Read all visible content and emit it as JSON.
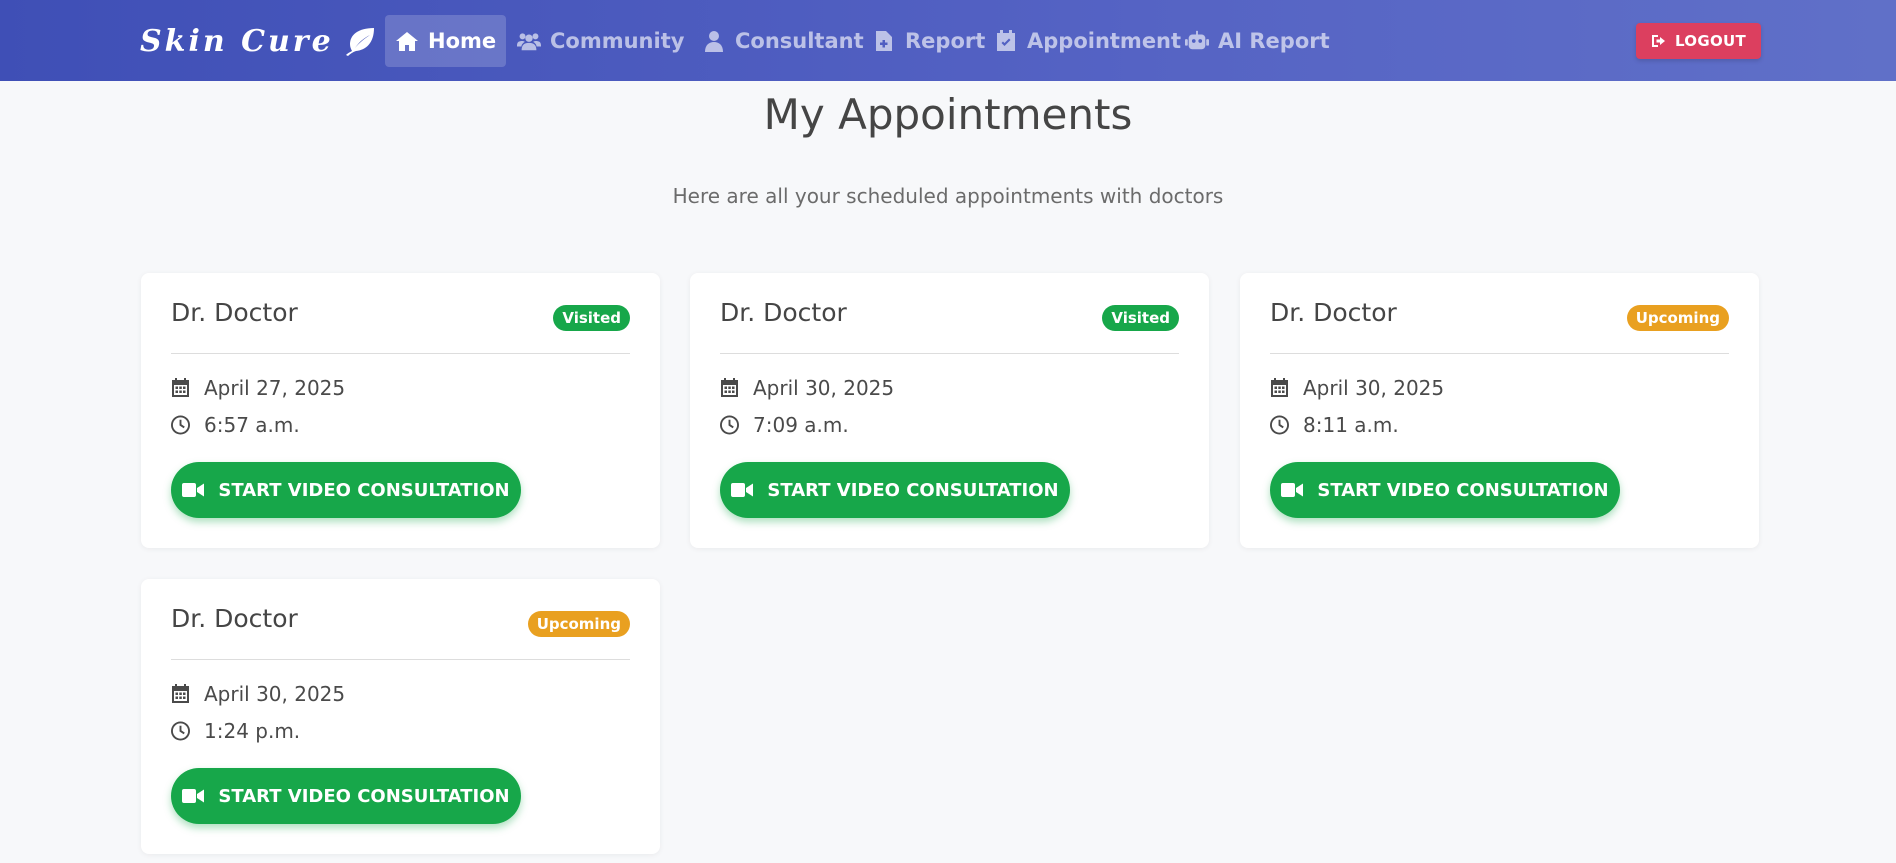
{
  "nav": {
    "brand": "Skin Cure",
    "items": [
      {
        "label": "Home",
        "icon": "home-icon",
        "active": true
      },
      {
        "label": "Community",
        "icon": "users-icon"
      },
      {
        "label": "Consultant",
        "icon": "user-doctor-icon"
      },
      {
        "label": "Report",
        "icon": "file-medical-icon"
      },
      {
        "label": "Appointment",
        "icon": "calendar-check-icon"
      },
      {
        "label": "AI Report",
        "icon": "robot-icon"
      }
    ],
    "logout_label": "LOGOUT"
  },
  "page": {
    "title": "My Appointments",
    "subtitle": "Here are all your scheduled appointments with doctors"
  },
  "appointments": [
    {
      "doctor": "Dr. Doctor",
      "status": "Visited",
      "date": "April 27, 2025",
      "time": "6:57 a.m.",
      "button": "START VIDEO CONSULTATION"
    },
    {
      "doctor": "Dr. Doctor",
      "status": "Visited",
      "date": "April 30, 2025",
      "time": "7:09 a.m.",
      "button": "START VIDEO CONSULTATION"
    },
    {
      "doctor": "Dr. Doctor",
      "status": "Upcoming",
      "date": "April 30, 2025",
      "time": "8:11 a.m.",
      "button": "START VIDEO CONSULTATION"
    },
    {
      "doctor": "Dr. Doctor",
      "status": "Upcoming",
      "date": "April 30, 2025",
      "time": "1:24 p.m.",
      "button": "START VIDEO CONSULTATION"
    }
  ],
  "colors": {
    "navbar": "#4a59bf",
    "visited": "#17a74a",
    "upcoming": "#e9a020",
    "logout": "#dc3f5f",
    "button": "#17a74a"
  }
}
